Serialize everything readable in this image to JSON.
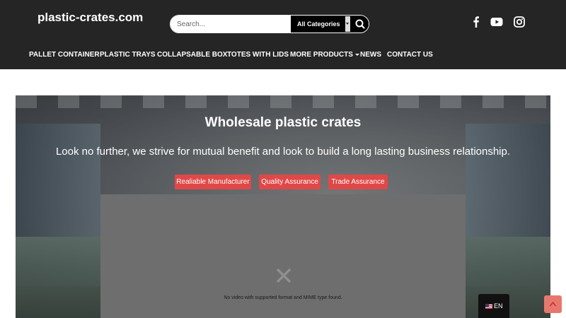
{
  "header": {
    "brand": "plastic-crates.com",
    "search": {
      "placeholder": "Search...",
      "category": "All Categories"
    },
    "social": [
      "facebook-icon",
      "youtube-icon",
      "instagram-icon"
    ]
  },
  "nav": {
    "items": [
      {
        "label": "PALLET CONTAINER"
      },
      {
        "label": "PLASTIC TRAYS"
      },
      {
        "label": "COLLAPSABLE BOX"
      },
      {
        "label": "TOTES WITH LIDS"
      },
      {
        "label": "MORE PRODUCTS"
      },
      {
        "label": "NEWS"
      },
      {
        "label": "CONTACT US"
      }
    ]
  },
  "hero": {
    "title": "Wholesale plastic crates",
    "subtitle": "Look no further, we strive for mutual benefit and look to build a long lasting business relationship.",
    "badges": [
      "Realiable Manufacturer",
      "Quality Assurance",
      "Trade Assurance"
    ]
  },
  "video": {
    "message": "No video with supported format and MIME type found."
  },
  "language": {
    "code": "EN"
  },
  "colors": {
    "header_bg": "#252525",
    "badge_red": "#e04848",
    "scroll_top": "#e8786e"
  }
}
